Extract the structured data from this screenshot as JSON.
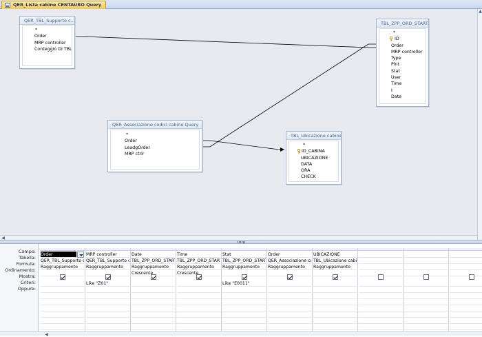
{
  "tab": {
    "title": "QER_Lista cabine CENTAURO Query"
  },
  "tables": {
    "supporto": {
      "title": "QER_TBL_Supporto c...",
      "fields": [
        "*",
        "Order",
        "MRP controller",
        "Conteggio DI TBL_Z"
      ]
    },
    "zpp_ord_start": {
      "title": "TBL_ZPP_ORD_START",
      "fields": [
        "*",
        "ID",
        "Order",
        "MRP controller",
        "Type",
        "Plnt",
        "Stat",
        "User",
        "Time",
        "I",
        "Date"
      ]
    },
    "associazione": {
      "title": "QER_Associazione codici cabine Query",
      "fields": [
        "*",
        "Order",
        "LeadgOrder",
        "MRP ctrlr"
      ]
    },
    "ubicazione": {
      "title": "TBL_Ubicazione cabine",
      "fields": [
        "*",
        "ID_CABINA",
        "UBICAZIONE",
        "DATA",
        "ORA",
        "CHECK"
      ]
    }
  },
  "grid": {
    "row_labels": [
      "Campo:",
      "Tabella:",
      "Formula:",
      "Ordinamento:",
      "Mostra:",
      "Criteri:",
      "Oppure:"
    ],
    "columns": [
      {
        "campo": "Order",
        "tabella": "QER_TBL_Supporto ca",
        "formula": "Raggruppamento",
        "ordinamento": "",
        "mostra": true,
        "criteri": "",
        "selected": true
      },
      {
        "campo": "MRP controller",
        "tabella": "QER_TBL_Supporto ca",
        "formula": "Raggruppamento",
        "ordinamento": "",
        "mostra": true,
        "criteri": "Like \"Z01\""
      },
      {
        "campo": "Date",
        "tabella": "TBL_ZPP_ORD_START",
        "formula": "Raggruppamento",
        "ordinamento": "Crescente",
        "mostra": true,
        "criteri": ""
      },
      {
        "campo": "Time",
        "tabella": "TBL_ZPP_ORD_START",
        "formula": "Raggruppamento",
        "ordinamento": "Crescente",
        "mostra": true,
        "criteri": ""
      },
      {
        "campo": "Stat",
        "tabella": "TBL_ZPP_ORD_START",
        "formula": "Raggruppamento",
        "ordinamento": "",
        "mostra": true,
        "criteri": "Like \"E0011\""
      },
      {
        "campo": "Order",
        "tabella": "QER_Associazione coo",
        "formula": "Raggruppamento",
        "ordinamento": "",
        "mostra": true,
        "criteri": ""
      },
      {
        "campo": "UBICAZIONE",
        "tabella": "TBL_Ubicazione cabin",
        "formula": "Raggruppamento",
        "ordinamento": "",
        "mostra": true,
        "criteri": ""
      },
      {
        "campo": "",
        "tabella": "",
        "formula": "",
        "ordinamento": "",
        "mostra": false,
        "criteri": ""
      },
      {
        "campo": "",
        "tabella": "",
        "formula": "",
        "ordinamento": "",
        "mostra": false,
        "criteri": ""
      },
      {
        "campo": "",
        "tabella": "",
        "formula": "",
        "ordinamento": "",
        "mostra": false,
        "criteri": ""
      }
    ]
  },
  "icons": {
    "key": "key-icon",
    "tab": "query-icon"
  },
  "colors": {
    "tab_bg": "#f7c95b",
    "design_bg": "#e8eaf0",
    "title_text": "#4a6591"
  }
}
